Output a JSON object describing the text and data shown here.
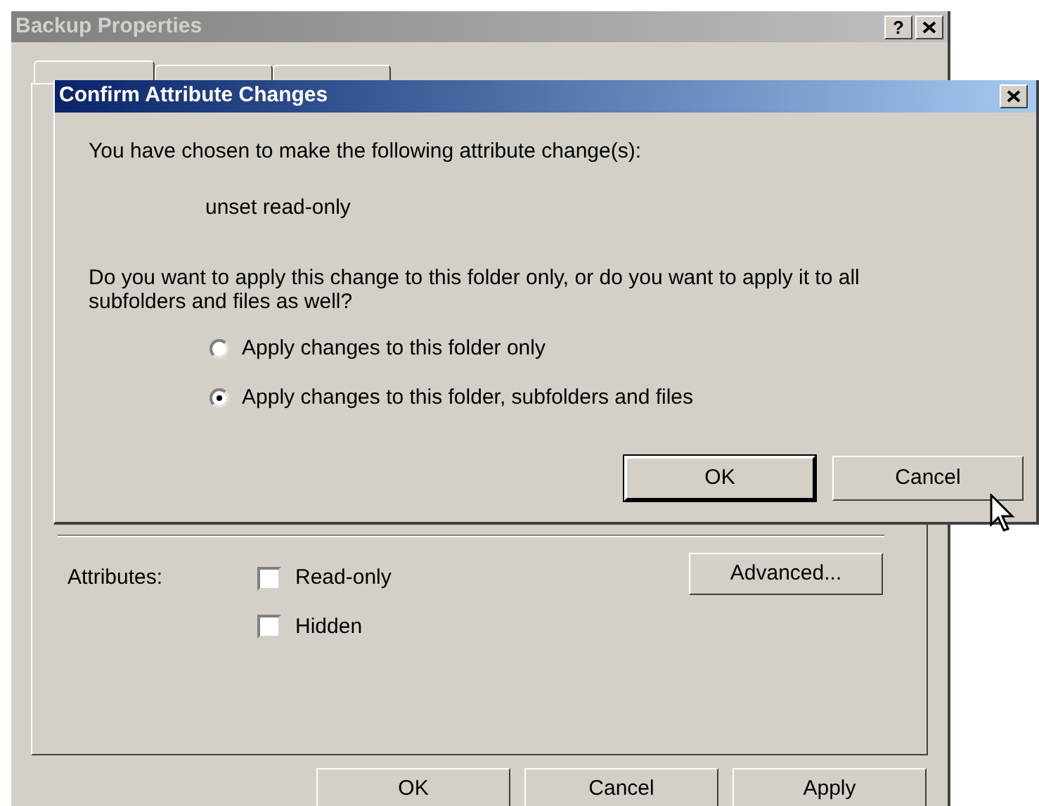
{
  "properties_window": {
    "title": "Backup Properties",
    "help_button": "?",
    "tabs": [
      {
        "selected": true
      },
      {
        "selected": false
      },
      {
        "selected": false
      }
    ],
    "attributes_label": "Attributes:",
    "checkboxes": [
      {
        "label": "Read-only",
        "checked": false
      },
      {
        "label": "Hidden",
        "checked": false
      }
    ],
    "advanced_button": "Advanced...",
    "buttons": [
      "OK",
      "Cancel",
      "Apply"
    ]
  },
  "dialog": {
    "title": "Confirm Attribute Changes",
    "message": "You have chosen to make the following attribute change(s):",
    "change": "unset read-only",
    "question": "Do you want to apply this change to this folder only, or do you want to apply it to all subfolders and files as well?",
    "options": [
      {
        "label": "Apply changes to this folder only",
        "selected": false
      },
      {
        "label": "Apply changes to this folder, subfolders and files",
        "selected": true
      }
    ],
    "buttons": [
      "OK",
      "Cancel"
    ]
  }
}
